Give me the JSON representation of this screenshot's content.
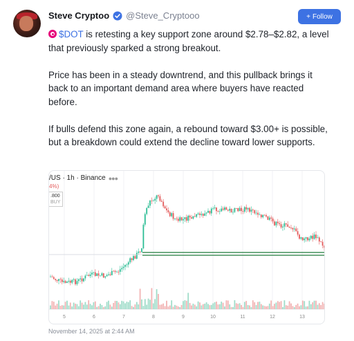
{
  "author": {
    "name": "Steve Cryptoo",
    "handle": "@Steve_Cryptooo"
  },
  "follow_label": "Follow",
  "post": {
    "ticker": "$DOT",
    "line1_rest": " is retesting a key support zone around $2.78–$2.82, a level that previously sparked a strong breakout.",
    "para2": "Price has been in a steady downtrend, and this pullback brings it back to an important demand area where buyers have reacted before.",
    "para3": "If bulls defend this zone again, a rebound toward $3.00+ is possible, but a breakdown could extend the decline toward lower supports."
  },
  "chart": {
    "title": "/US · 1h · Binance",
    "change": "4%)",
    "price": ".800",
    "buy": "BUY",
    "x_ticks": [
      "5",
      "6",
      "7",
      "8",
      "9",
      "10",
      "11",
      "12",
      "13"
    ]
  },
  "timestamp": "November 14, 2025 at 2:44 AM",
  "colors": {
    "accent": "#3d72e3",
    "up": "#2bbd94",
    "down": "#e35a5a",
    "support_line": "#1f7a3a"
  }
}
